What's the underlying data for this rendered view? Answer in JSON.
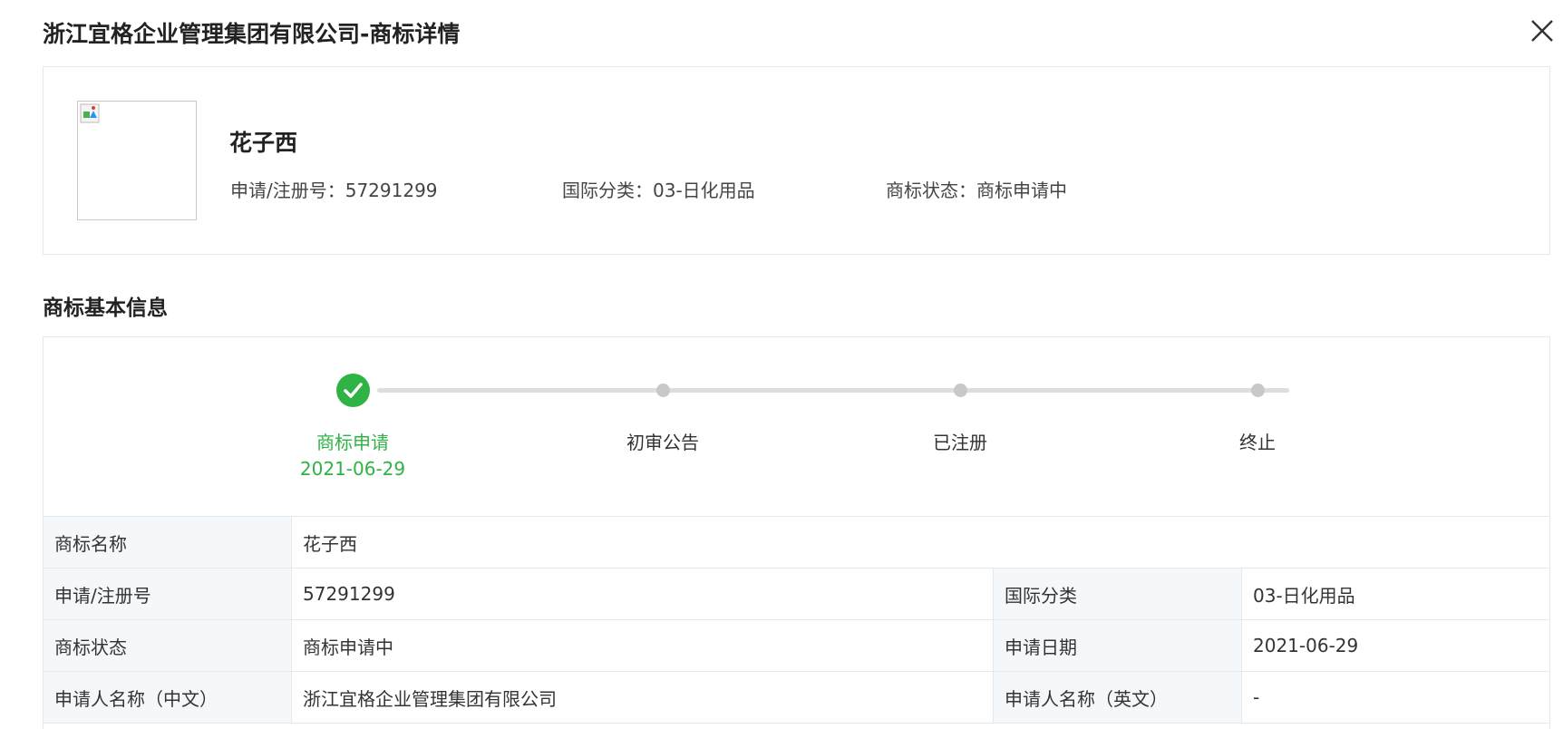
{
  "dialog": {
    "title": "浙江宜格企业管理集团有限公司-商标详情"
  },
  "trademark_card": {
    "name": "花子西",
    "registration_text": "申请/注册号：57291299",
    "class_text": "国际分类：03-日化用品",
    "status_text": "商标状态：商标申请中"
  },
  "basic_info": {
    "section_title": "商标基本信息",
    "steps": [
      {
        "label": "商标申请",
        "date": "2021-06-29",
        "state": "done"
      },
      {
        "label": "初审公告",
        "date": "",
        "state": "pending"
      },
      {
        "label": "已注册",
        "date": "",
        "state": "pending"
      },
      {
        "label": "终止",
        "date": "",
        "state": "pending"
      }
    ],
    "table": {
      "row1": {
        "label": "商标名称",
        "value": "花子西"
      },
      "row2": {
        "label1": "申请/注册号",
        "value1": "57291299",
        "label2": "国际分类",
        "value2": "03-日化用品"
      },
      "row3": {
        "label1": "商标状态",
        "value1": "商标申请中",
        "label2": "申请日期",
        "value2": "2021-06-29"
      },
      "row4": {
        "label1": "申请人名称（中文）",
        "value1": "浙江宜格企业管理集团有限公司",
        "label2": "申请人名称（英文）",
        "value2": "-"
      }
    }
  },
  "colors": {
    "accent_green": "#2fb344",
    "label_bg": "#f4f8fb",
    "border": "#e8e8e8"
  },
  "icons": {
    "close": "close-icon",
    "check": "check-icon",
    "broken_image": "broken-image-icon"
  }
}
